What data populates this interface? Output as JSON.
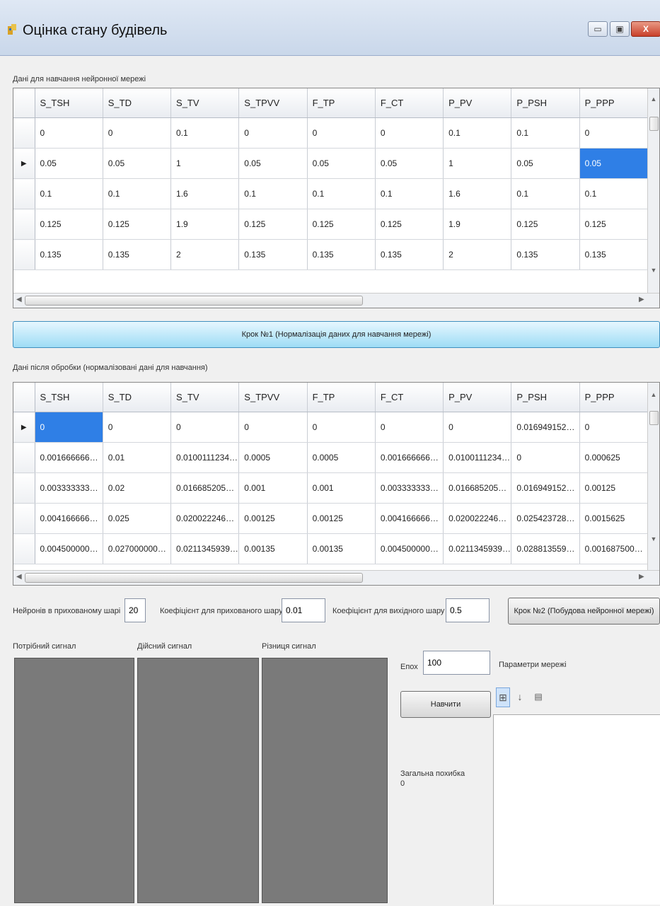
{
  "window": {
    "title": "Оцінка стану будівель",
    "minimize_label": "▭",
    "maximize_label": "▣",
    "close_label": "X"
  },
  "training_section": {
    "label": "Дані для навчання нейронної мережі",
    "columns": [
      "S_TSH",
      "S_TD",
      "S_TV",
      "S_TPVV",
      "F_TP",
      "F_CT",
      "P_PV",
      "P_PSH",
      "P_PPP"
    ],
    "rows": [
      {
        "marker": "",
        "cells": [
          "0",
          "0",
          "0.1",
          "0",
          "0",
          "0",
          "0.1",
          "0.1",
          "0"
        ]
      },
      {
        "marker": "▶",
        "cells": [
          "0.05",
          "0.05",
          "1",
          "0.05",
          "0.05",
          "0.05",
          "1",
          "0.05",
          "0.05"
        ]
      },
      {
        "marker": "",
        "cells": [
          "0.1",
          "0.1",
          "1.6",
          "0.1",
          "0.1",
          "0.1",
          "1.6",
          "0.1",
          "0.1"
        ]
      },
      {
        "marker": "",
        "cells": [
          "0.125",
          "0.125",
          "1.9",
          "0.125",
          "0.125",
          "0.125",
          "1.9",
          "0.125",
          "0.125"
        ]
      },
      {
        "marker": "",
        "cells": [
          "0.135",
          "0.135",
          "2",
          "0.135",
          "0.135",
          "0.135",
          "2",
          "0.135",
          "0.135"
        ]
      }
    ]
  },
  "step1_button": "Крок №1 (Нормалізація даних для навчання мережі)",
  "normalized_section": {
    "label": "Дані після обробки (нормалізовані дані для навчання)",
    "columns": [
      "S_TSH",
      "S_TD",
      "S_TV",
      "S_TPVV",
      "F_TP",
      "F_CT",
      "P_PV",
      "P_PSH",
      "P_PPP"
    ],
    "rows": [
      {
        "marker": "▶",
        "cells": [
          "0",
          "0",
          "0",
          "0",
          "0",
          "0",
          "0",
          "0.016949152542...",
          "0"
        ]
      },
      {
        "marker": "",
        "cells": [
          "0.001666666666...",
          "0.01",
          "0.010011123470...",
          "0.0005",
          "0.0005",
          "0.001666666666...",
          "0.010011123470...",
          "0",
          "0.000625"
        ]
      },
      {
        "marker": "",
        "cells": [
          "0.003333333333...",
          "0.02",
          "0.016685205784...",
          "0.001",
          "0.001",
          "0.003333333333...",
          "0.016685205784...",
          "0.016949152542...",
          "0.00125"
        ]
      },
      {
        "marker": "",
        "cells": [
          "0.004166666666...",
          "0.025",
          "0.020022246941...",
          "0.00125",
          "0.00125",
          "0.004166666666...",
          "0.020022246941...",
          "0.025423728813...",
          "0.0015625"
        ]
      },
      {
        "marker": "",
        "cells": [
          "0.004500000000...",
          "0.027000000000...",
          "0.021134593993...",
          "0.00135",
          "0.00135",
          "0.004500000000...",
          "0.021134593993...",
          "0.028813559322...",
          "0.001687500000"
        ]
      }
    ]
  },
  "params": {
    "hidden_neurons_label": "Нейронів в прихованому шарі",
    "hidden_neurons_value": "20",
    "hidden_coef_label": "Коефіцієнт для прихованого шару",
    "hidden_coef_value": "0.01",
    "output_coef_label": "Коефіцієнт для вихідного шару",
    "output_coef_value": "0.5",
    "step2_button": "Крок №2 (Побудова нейронної мережі)"
  },
  "signals": {
    "required_label": "Потрібний сигнал",
    "actual_label": "Дійсний сигнал",
    "difference_label": "Різниця сигнал"
  },
  "training": {
    "epochs_label": "Епох",
    "epochs_value": "100",
    "train_button": "Навчити",
    "total_error_label": "Загальна похибка",
    "total_error_value": "0"
  },
  "network_params": {
    "label": "Параметри мережі"
  },
  "colors": {
    "selected_cell": "#2f7fe6",
    "signal_panel": "#7a7a7a",
    "step1_button": "#9edcf5"
  }
}
